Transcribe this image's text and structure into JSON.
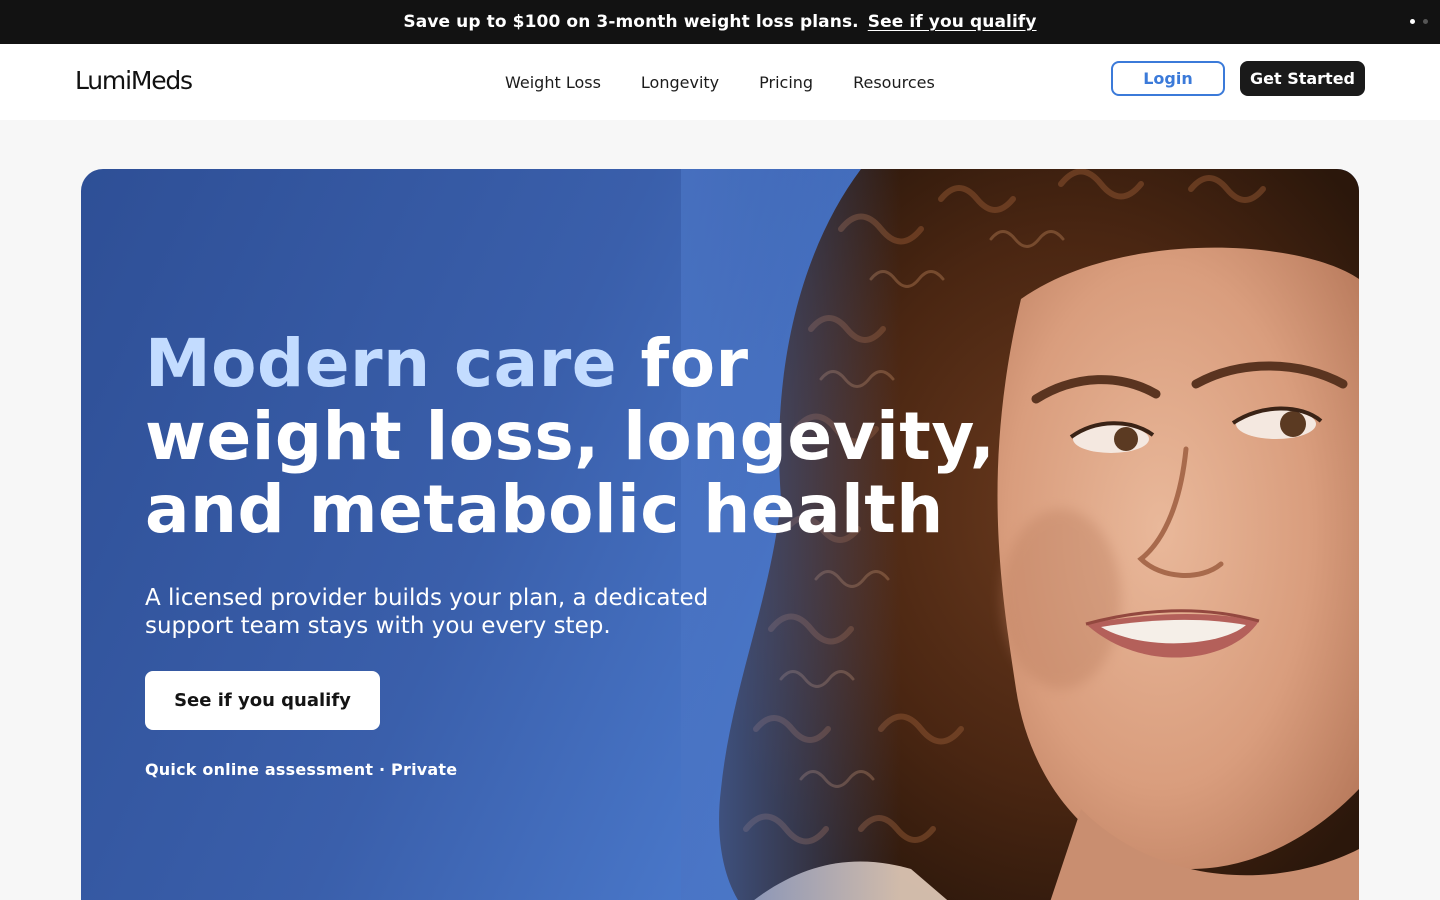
{
  "promo": {
    "text": "Save up to $100 on 3-month weight loss plans.",
    "link": "See if you qualify"
  },
  "header": {
    "logo": "LumiMeds",
    "nav": [
      "Weight Loss",
      "Longevity",
      "Pricing",
      "Resources"
    ],
    "login": "Login",
    "get_started": "Get Started"
  },
  "hero": {
    "headline_accent": "Modern care",
    "headline_rest_1": " for",
    "headline_line_2": "weight loss, longevity,",
    "headline_line_3": "and metabolic health",
    "subhead": "A licensed provider builds your plan, a dedicated support team stays with you every step.",
    "cta": "See if you qualify",
    "fine_print": "Quick online assessment · Private"
  },
  "colors": {
    "promo_bg": "#121212",
    "accent_blue": "#3b7ad9",
    "hero_blue": "#3a5fab",
    "headline_accent": "#c3dcff",
    "dark_button": "#1a1a1a"
  }
}
